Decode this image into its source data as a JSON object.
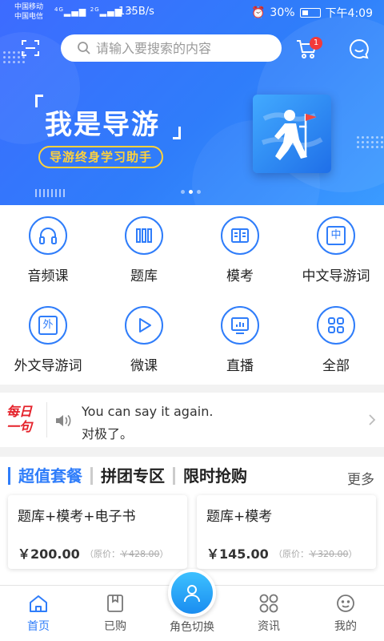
{
  "status_bar": {
    "carrier_1": "中国移动",
    "carrier_2": "中国电信",
    "net_1": "4G",
    "net_2": "2G",
    "speed": "135B/s",
    "battery": "30%",
    "time": "下午4:09"
  },
  "header": {
    "search_placeholder": "请输入要搜索的内容",
    "cart_badge": "1"
  },
  "banner": {
    "title": "我是导游",
    "subtitle": "导游终身学习助手",
    "page_count": 3,
    "active_page": 1
  },
  "categories": [
    {
      "label": "音频课",
      "icon": "headphones-icon"
    },
    {
      "label": "题库",
      "icon": "books-icon"
    },
    {
      "label": "模考",
      "icon": "open-book-icon"
    },
    {
      "label": "中文导游词",
      "icon": "chinese-char-icon",
      "glyph": "中"
    },
    {
      "label": "外文导游词",
      "icon": "foreign-char-icon",
      "glyph": "外"
    },
    {
      "label": "微课",
      "icon": "play-icon"
    },
    {
      "label": "直播",
      "icon": "live-screen-icon"
    },
    {
      "label": "全部",
      "icon": "grid-icon"
    }
  ],
  "daily": {
    "logo_line_1": "每日",
    "logo_line_2": "一句",
    "sentence_en": "You can say it again.",
    "sentence_cn": "对极了。"
  },
  "promo": {
    "tabs": [
      "超值套餐",
      "拼团专区",
      "限时抢购"
    ],
    "more": "更多",
    "cards": [
      {
        "title": "题库+模考+电子书",
        "price": "￥200.00",
        "orig_label": "（原价：",
        "orig_price": "￥428.00",
        "orig_close": "）"
      },
      {
        "title": "题库+模考",
        "price": "￥145.00",
        "orig_label": "（原价：",
        "orig_price": "￥320.00",
        "orig_close": "）"
      }
    ]
  },
  "nav": {
    "items": [
      {
        "label": "首页",
        "icon": "home-icon",
        "active": true
      },
      {
        "label": "已购",
        "icon": "purchased-icon",
        "active": false
      },
      {
        "label": "资讯",
        "icon": "news-icon",
        "active": false
      },
      {
        "label": "我的",
        "icon": "profile-icon",
        "active": false
      }
    ],
    "role_switch": "角色切换"
  },
  "colors": {
    "accent": "#2f7dfa",
    "brand_red": "#e5222b",
    "badge_red": "#f23a3a",
    "banner_yellow": "#ffd23a"
  }
}
